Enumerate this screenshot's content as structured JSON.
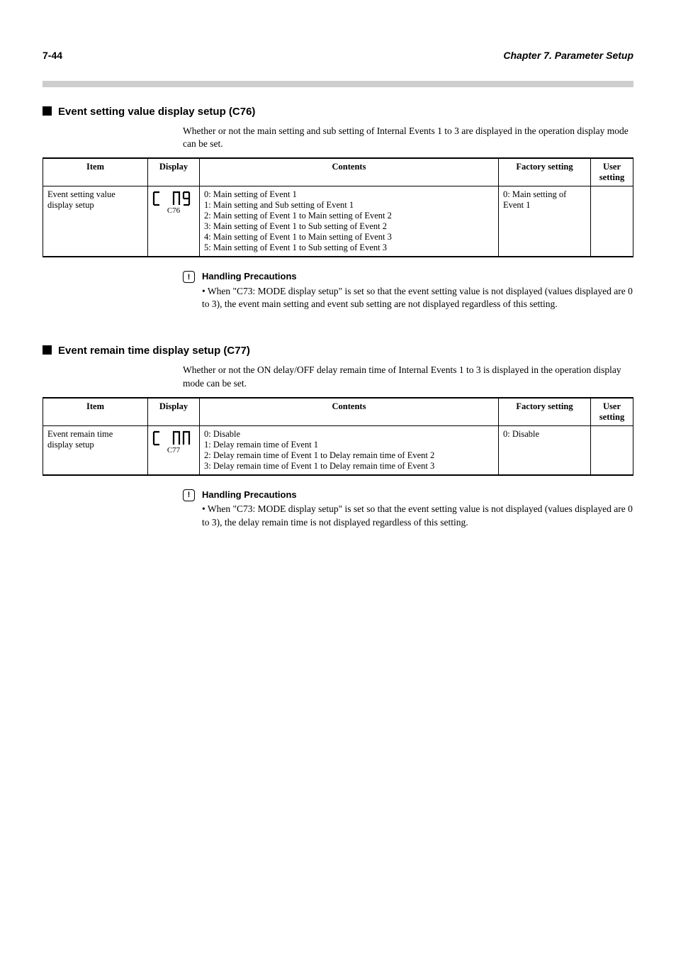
{
  "header": {
    "page_no": "7-44",
    "chapter": "Chapter 7. Parameter Setup"
  },
  "sections": [
    {
      "title": "Event setting value display setup (C76)",
      "intro": "Whether or not the main setting and sub setting of Internal Events 1 to 3 are displayed in the operation display mode can be set.",
      "table": {
        "headers": [
          "Item",
          "Display",
          "Contents",
          "Factory setting",
          "User setting"
        ],
        "row": {
          "item_line1": "Event setting value",
          "item_line2": "display setup",
          "display_seg": "C  76",
          "display_sub": "C76",
          "contents": "0: Main setting of Event 1\n1: Main setting and Sub setting of Event 1\n2: Main setting of Event 1 to Main setting of Event 2\n3: Main setting of Event 1 to Sub setting of Event 2\n4: Main setting of Event 1 to Main setting of Event 3\n5: Main setting of Event 1 to Sub setting of Event 3",
          "factory": "0: Main setting of Event 1",
          "user": ""
        }
      },
      "caution_label": "Handling Precautions",
      "caution_body": "• When \"C73: MODE display setup\" is set so that the event setting value is not displayed (values displayed are 0 to 3), the event main setting and event sub setting are not displayed regardless of this setting."
    },
    {
      "title": "Event remain time display setup (C77)",
      "intro": "Whether or not the ON delay/OFF delay remain time of Internal Events 1 to 3 is displayed in the operation display mode can be set.",
      "table": {
        "headers": [
          "Item",
          "Display",
          "Contents",
          "Factory setting",
          "User setting"
        ],
        "row": {
          "item_line1": "Event remain time",
          "item_line2": "display setup",
          "display_seg": "C  77",
          "display_sub": "C77",
          "contents": "0: Disable\n1: Delay remain time of Event 1\n2: Delay remain time of Event 1 to Delay remain time of Event 2\n3: Delay remain time of Event 1 to Delay remain time of Event 3",
          "factory": "0: Disable",
          "user": ""
        }
      },
      "caution_label": "Handling Precautions",
      "caution_body": "• When \"C73: MODE display setup\" is set so that the event setting value is not displayed (values displayed are 0 to 3), the delay remain time is not displayed regardless of this setting."
    }
  ]
}
